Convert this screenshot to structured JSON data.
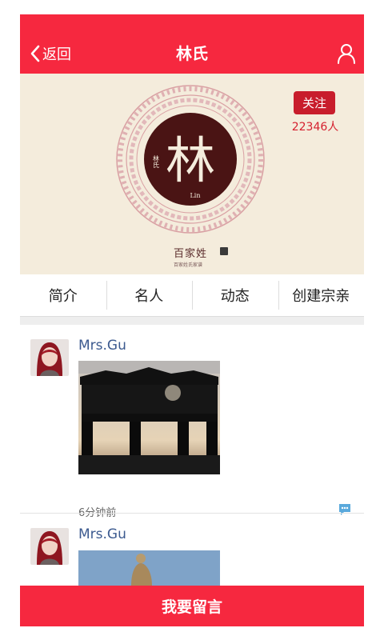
{
  "header": {
    "back_label": "返回",
    "title": "林氏"
  },
  "banner": {
    "seal_char": "林",
    "seal_side_text": "林氏",
    "seal_latin": "Lin",
    "brand_main": "百家姓",
    "brand_sub": "百家姓氏家谱",
    "follow_label": "关注",
    "follow_count": "22346人"
  },
  "tabs": [
    {
      "label": "简介"
    },
    {
      "label": "名人"
    },
    {
      "label": "动态"
    },
    {
      "label": "创建宗亲"
    }
  ],
  "posts": [
    {
      "author": "Mrs.Gu",
      "time": "6分钟前"
    },
    {
      "author": "Mrs.Gu"
    }
  ],
  "bottom_bar": {
    "label": "我要留言"
  },
  "colors": {
    "accent": "#f6283f",
    "follow": "#c81d2c",
    "author": "#3c5a8f",
    "banner_bg": "#f4ecdc",
    "seal": "#4a1414"
  }
}
